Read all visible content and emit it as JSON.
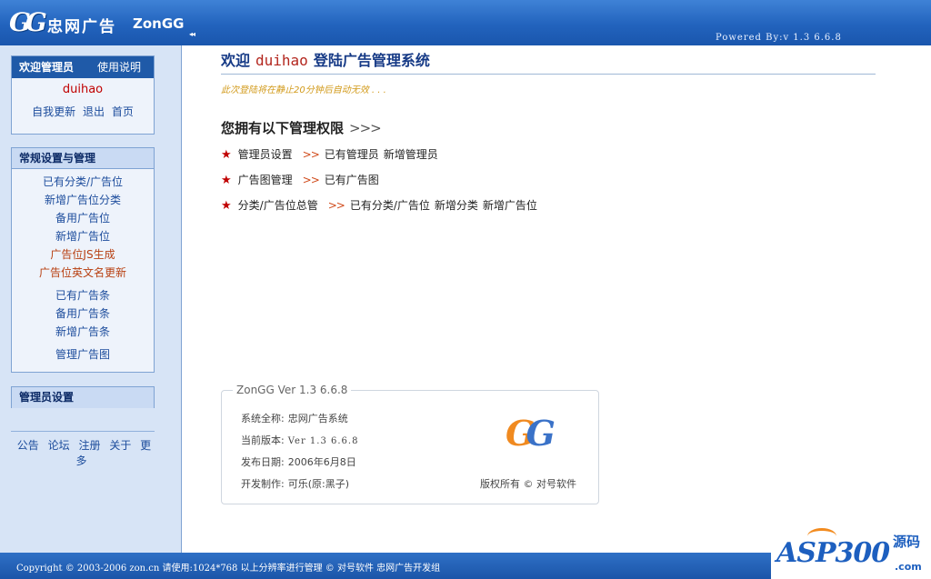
{
  "header": {
    "logo_mark": "GG",
    "logo_cn": "忠网广告",
    "logo_en": "ZonGG",
    "collapse_glyph": "◂◂",
    "powered_by": "Powered By:v 1.3 6.6.8"
  },
  "sidebar": {
    "admin_box": {
      "title": "欢迎管理员",
      "help": "使用说明",
      "username": "duihao",
      "links": [
        "自我更新",
        "退出",
        "首页"
      ]
    },
    "settings_box": {
      "title": "常规设置与管理",
      "items": [
        {
          "label": "已有分类/广告位",
          "highlight": false
        },
        {
          "label": "新增广告位分类",
          "highlight": false
        },
        {
          "label": "备用广告位",
          "highlight": false
        },
        {
          "label": "新增广告位",
          "highlight": false
        },
        {
          "label": "广告位JS生成",
          "highlight": true
        },
        {
          "label": "广告位英文名更新",
          "highlight": true
        },
        {
          "label": "已有广告条",
          "highlight": false
        },
        {
          "label": "备用广告条",
          "highlight": false
        },
        {
          "label": "新增广告条",
          "highlight": false
        },
        {
          "label": "管理广告图",
          "highlight": false
        }
      ]
    },
    "admin_settings": {
      "title": "管理员设置"
    },
    "bottom_links": [
      "公告",
      "论坛",
      "注册",
      "关于",
      "更多"
    ]
  },
  "main": {
    "welcome_prefix": "欢迎",
    "welcome_user": "duihao",
    "welcome_suffix": "登陆广告管理系统",
    "notice": "此次登陆将在静止20分钟后自动无效 . . .",
    "perm_title": "您拥有以下管理权限",
    "perm_arrow": ">>>",
    "permissions": [
      {
        "group": "管理员设置",
        "links": [
          "已有管理员",
          "新增管理员"
        ]
      },
      {
        "group": "广告图管理",
        "links": [
          "已有广告图"
        ]
      },
      {
        "group": "分类/广告位总管",
        "links": [
          "已有分类/广告位",
          "新增分类",
          "新增广告位"
        ]
      }
    ],
    "version_box": {
      "legend": "ZonGG Ver 1.3 6.6.8",
      "rows": [
        {
          "label": "系统全称:",
          "value": "忠网广告系统"
        },
        {
          "label": "当前版本:",
          "value": "Ver 1.3 6.6.8"
        },
        {
          "label": "发布日期:",
          "value": "2006年6月8日"
        },
        {
          "label": "开发制作:",
          "value": "可乐(原:黑子)"
        }
      ],
      "copyright": "版权所有 © 对号软件"
    }
  },
  "footer": {
    "text": "Copyright © 2003-2006 zon.cn 请使用:1024*768 以上分辨率进行管理 © 对号软件 忠网广告开发组"
  },
  "watermark": {
    "brand": "ASP300",
    "cn": "源码",
    "com": ".com"
  },
  "colors": {
    "header_blue": "#2263bd",
    "sidebar_bg": "#d7e4f6",
    "title_blue": "#163a86",
    "accent_red": "#c00000"
  }
}
